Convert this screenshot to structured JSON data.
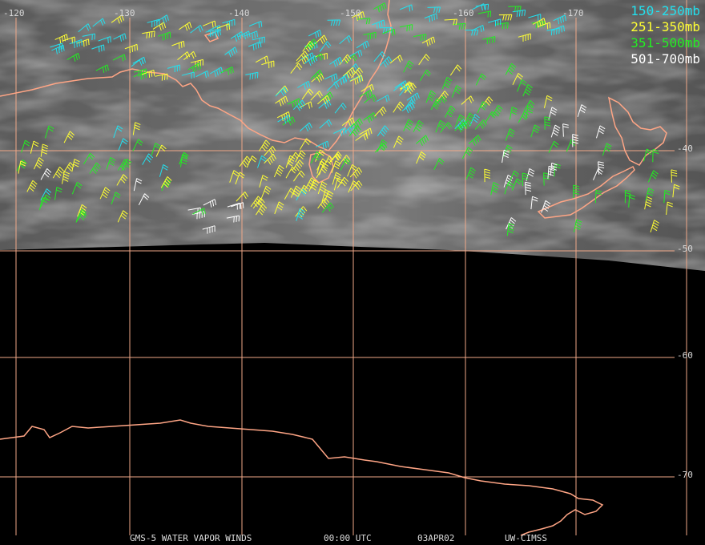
{
  "footer": {
    "product": "GMS-5 WATER VAPOR WINDS",
    "time": "00:00 UTC",
    "date": "03APR02",
    "source": "UW-CIMSS"
  },
  "legend": [
    {
      "label": "150-250mb",
      "color": "#22e0ee"
    },
    {
      "label": "251-350mb",
      "color": "#ffff33"
    },
    {
      "label": "351-500mb",
      "color": "#22ee22"
    },
    {
      "label": "501-700mb",
      "color": "#ffffff"
    }
  ],
  "graticule": {
    "longitudes": [
      {
        "label": "-120",
        "lon": -120
      },
      {
        "label": "-130",
        "lon": -130
      },
      {
        "label": "-140",
        "lon": -140
      },
      {
        "label": "-150",
        "lon": -150
      },
      {
        "label": "-160",
        "lon": -160
      },
      {
        "label": "-170",
        "lon": -170
      }
    ],
    "latitudes": [
      {
        "label": "-40",
        "lat": -40
      },
      {
        "label": "-50",
        "lat": -50
      },
      {
        "label": "-60",
        "lat": -60
      },
      {
        "label": "-70",
        "lat": -70
      }
    ]
  },
  "colors": {
    "grid": "#f0a888",
    "coast": "#ffa585",
    "background": "#000000"
  }
}
